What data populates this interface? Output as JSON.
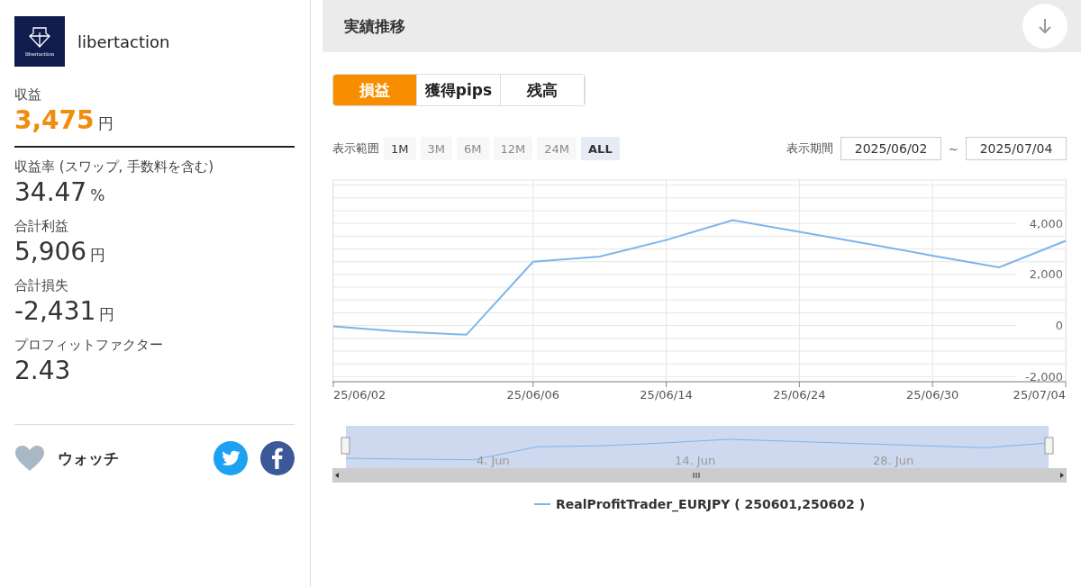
{
  "profile": {
    "name": "libertaction",
    "logo_text": "libertaction"
  },
  "stats": [
    {
      "label": "収益",
      "value": "3,475",
      "unit": "円",
      "kind": "highlight"
    },
    {
      "label": "収益率 (スワップ, 手数料を含む)",
      "value": "34.47",
      "unit": "%",
      "kind": "plain"
    },
    {
      "label": "合計利益",
      "value": "5,906",
      "unit": "円",
      "kind": "plain"
    },
    {
      "label": "合計損失",
      "value": "-2,431",
      "unit": "円",
      "kind": "plain"
    },
    {
      "label": "プロフィットファクター",
      "value": "2.43",
      "kind": "plain"
    }
  ],
  "watch": {
    "label": "ウォッチ",
    "on": false
  },
  "section": {
    "title": "実績推移"
  },
  "tabs": [
    {
      "label": "損益",
      "selected": true
    },
    {
      "label": "獲得pips",
      "selected": false
    },
    {
      "label": "残高",
      "selected": false
    }
  ],
  "range": {
    "label": "表示範囲",
    "options": [
      {
        "label": "1M",
        "disabled": false,
        "selected": false
      },
      {
        "label": "3M",
        "disabled": true,
        "selected": false
      },
      {
        "label": "6M",
        "disabled": true,
        "selected": false
      },
      {
        "label": "12M",
        "disabled": true,
        "selected": false
      },
      {
        "label": "24M",
        "disabled": true,
        "selected": false
      },
      {
        "label": "ALL",
        "disabled": false,
        "selected": true
      }
    ]
  },
  "period": {
    "label": "表示期間",
    "from": "2025/06/02",
    "separator": "~",
    "to": "2025/07/04"
  },
  "chart_data": {
    "type": "line",
    "grid": true,
    "ylim": [
      -2200,
      5700
    ],
    "categories": [
      "25/06/02",
      null,
      null,
      "25/06/06",
      null,
      "25/06/14",
      null,
      "25/06/24",
      null,
      "25/06/30",
      null,
      "25/07/04"
    ],
    "yticks": [
      {
        "value": -2000,
        "label": "-2,000"
      },
      {
        "value": 0,
        "label": "0"
      },
      {
        "value": 2000,
        "label": "2,000"
      },
      {
        "value": 4000,
        "label": "4,000"
      }
    ],
    "series": [
      {
        "name": "RealProfitTrader_EURJPY ( 250601,250602 )",
        "color": "#7cb5ec",
        "values": [
          -30,
          -230,
          -360,
          2500,
          2700,
          3350,
          4130,
          3670,
          3210,
          2740,
          2280,
          3320
        ]
      }
    ]
  },
  "navigator": {
    "labels": [
      "4. Jun",
      "14. Jun",
      "28. Jun"
    ]
  }
}
